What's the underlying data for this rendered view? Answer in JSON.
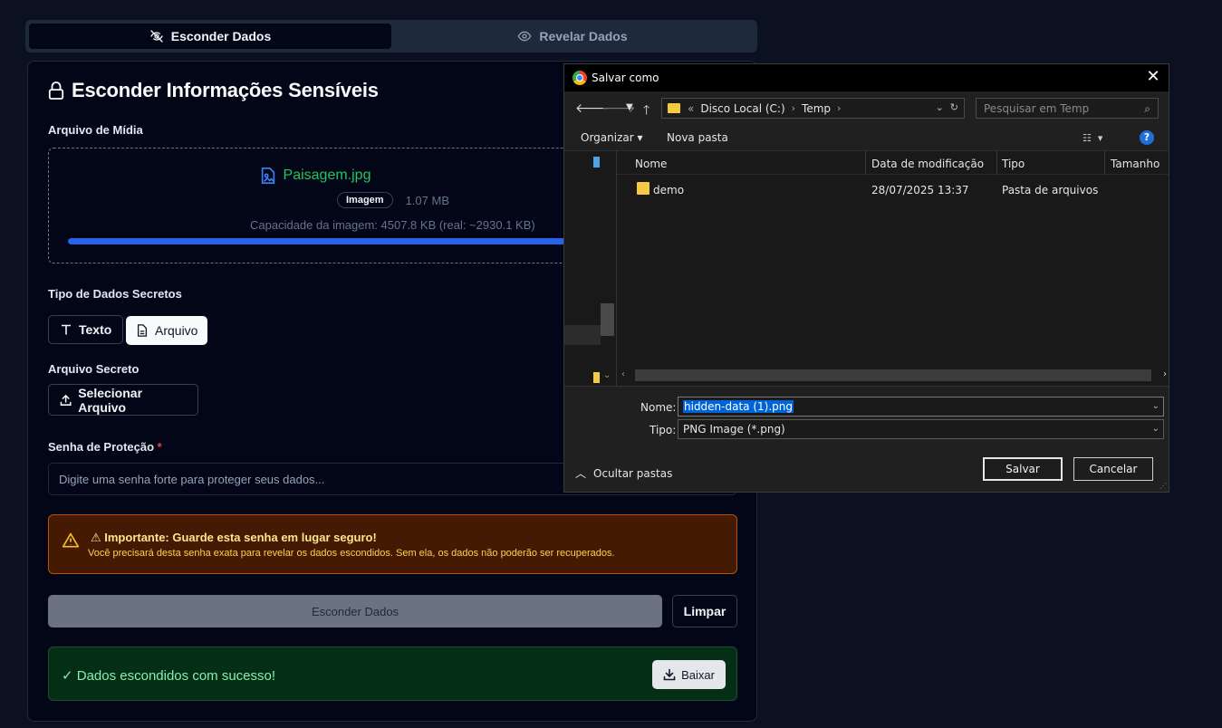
{
  "tabs": {
    "hide": "Esconder Dados",
    "reveal": "Revelar Dados"
  },
  "card": {
    "title": "Esconder Informações Sensíveis",
    "media_label": "Arquivo de Mídia",
    "file_name": "Paisagem.jpg",
    "file_badge": "Imagem",
    "file_size": "1.07 MB",
    "capacity": "Capacidade da imagem: 4507.8 KB (real: ~2930.1 KB)",
    "capacity_fill_percent": 98,
    "secret_type_label": "Tipo de Dados Secretos",
    "type_text": "Texto",
    "type_file": "Arquivo",
    "secret_file_label": "Arquivo Secreto",
    "select_file": "Selecionar Arquivo",
    "password_label": "Senha de Proteção",
    "required_mark": "*",
    "password_placeholder": "Digite uma senha forte para proteger seus dados...",
    "warning_title": "⚠ Importante: Guarde esta senha em lugar seguro!",
    "warning_text": "Você precisará desta senha exata para revelar os dados escondidos. Sem ela, os dados não poderão ser recuperados.",
    "submit": "Esconder Dados",
    "clear": "Limpar",
    "success": "✓ Dados escondidos com sucesso!",
    "download": "Baixar"
  },
  "dialog": {
    "title": "Salvar como",
    "close": "✕",
    "breadcrumb_prefix": "«",
    "breadcrumb": [
      "Disco Local (C:)",
      "Temp"
    ],
    "search_placeholder": "Pesquisar em Temp",
    "organize": "Organizar ▾",
    "new_folder": "Nova pasta",
    "help": "?",
    "columns": [
      "Nome",
      "Data de modificação",
      "Tipo",
      "Tamanho"
    ],
    "rows": [
      {
        "name": "demo",
        "date": "28/07/2025 13:37",
        "type": "Pasta de arquivos"
      }
    ],
    "name_label": "Nome:",
    "name_value": "hidden-data (1).png",
    "type_label": "Tipo:",
    "type_value": "PNG Image (*.png)",
    "hide_folders": "Ocultar pastas",
    "save": "Salvar",
    "cancel": "Cancelar",
    "colors": {
      "selection": "#0064d8",
      "folder": "#f5c942"
    }
  }
}
